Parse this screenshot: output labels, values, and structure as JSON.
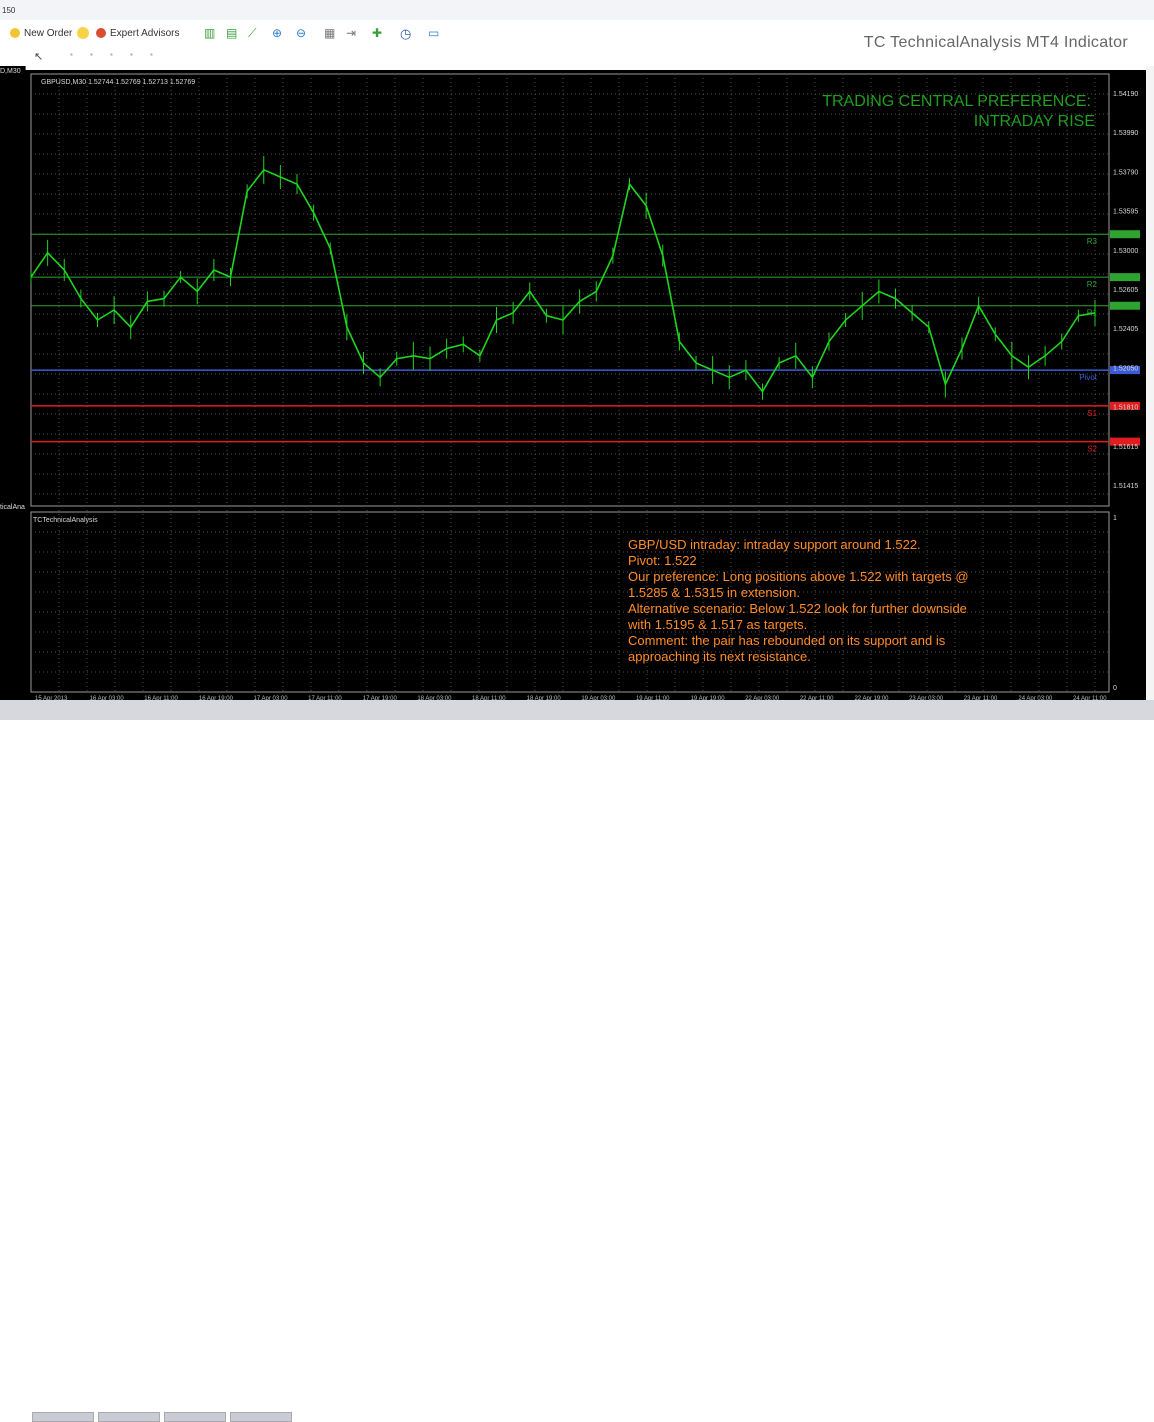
{
  "window": {
    "symbol_fragment": "150",
    "indicator_title": "TC TechnicalAnalysis MT4 Indicator"
  },
  "toolbar": {
    "new_order_label": "New Order",
    "expert_advisors_label": "Expert Advisors"
  },
  "sidebar": {
    "fragment_top": "D,M30",
    "fragment_bottom": "ticalAna"
  },
  "chart": {
    "header": "GBPUSD,M30  1.52744 1.52769 1.52713 1.52769",
    "preference_line1": "TRADING CENTRAL PREFERENCE:",
    "preference_line2": "INTRADAY RISE",
    "price_ticks": [
      "1.54190",
      "1.53990",
      "1.53790",
      "1.53595",
      "1.53000",
      "1.52605",
      "1.52405",
      "1.52050",
      "1.51810",
      "1.51615",
      "1.51415"
    ],
    "levels": [
      {
        "label": "R3",
        "price": 1.5315,
        "color": "#2fa32f"
      },
      {
        "label": "R2",
        "price": 1.5285,
        "color": "#2fa32f"
      },
      {
        "label": "R1",
        "price": 1.5265,
        "color": "#2fa32f"
      },
      {
        "label": "Pivot",
        "price": 1.522,
        "color": "#3b5bd6"
      },
      {
        "label": "S1",
        "price": 1.5195,
        "color": "#e01e1e"
      },
      {
        "label": "S2",
        "price": 1.517,
        "color": "#e01e1e"
      }
    ],
    "date_ticks": [
      "15 Apr 2013",
      "16 Apr 03:00",
      "16 Apr 11:00",
      "16 Apr 19:00",
      "17 Apr 03:00",
      "17 Apr 11:00",
      "17 Apr 19:00",
      "18 Apr 03:00",
      "18 Apr 11:00",
      "18 Apr 19:00",
      "19 Apr 03:00",
      "19 Apr 11:00",
      "19 Apr 19:00",
      "22 Apr 03:00",
      "22 Apr 11:00",
      "22 Apr 19:00",
      "23 Apr 03:00",
      "23 Apr 11:00",
      "24 Apr 03:00",
      "24 Apr 11:00"
    ],
    "price_series": [
      1.5285,
      1.5302,
      1.529,
      1.527,
      1.5255,
      1.5262,
      1.525,
      1.5268,
      1.527,
      1.5285,
      1.5275,
      1.529,
      1.5285,
      1.5345,
      1.536,
      1.5355,
      1.535,
      1.533,
      1.5305,
      1.525,
      1.5225,
      1.5215,
      1.5228,
      1.523,
      1.5228,
      1.5235,
      1.5238,
      1.523,
      1.5255,
      1.526,
      1.5275,
      1.5258,
      1.5255,
      1.5268,
      1.5275,
      1.53,
      1.535,
      1.5335,
      1.53,
      1.524,
      1.5225,
      1.522,
      1.5215,
      1.522,
      1.5205,
      1.5225,
      1.523,
      1.5215,
      1.524,
      1.5255,
      1.5265,
      1.5275,
      1.527,
      1.526,
      1.525,
      1.521,
      1.5235,
      1.5265,
      1.5245,
      1.523,
      1.5222,
      1.523,
      1.524,
      1.5258,
      1.526
    ]
  },
  "subwindow": {
    "label": "TCTechnicalAnalysis",
    "scale_top": "1",
    "scale_bottom": "0",
    "commentary": [
      "GBP/USD intraday: intraday support around 1.522.",
      "Pivot: 1.522",
      "Our preference: Long positions above 1.522 with targets @",
      "1.5285 & 1.5315 in extension.",
      "Alternative scenario: Below 1.522 look for further downside",
      "with 1.5195 & 1.517 as targets.",
      "Comment: the pair has rebounded on its support and is",
      "approaching its next resistance."
    ]
  },
  "colors": {
    "background": "#000000",
    "candles": "#1fd51f",
    "grid": "#4a4f4a",
    "commentary": "#ff8c2a",
    "preference": "#1f9e1f"
  }
}
